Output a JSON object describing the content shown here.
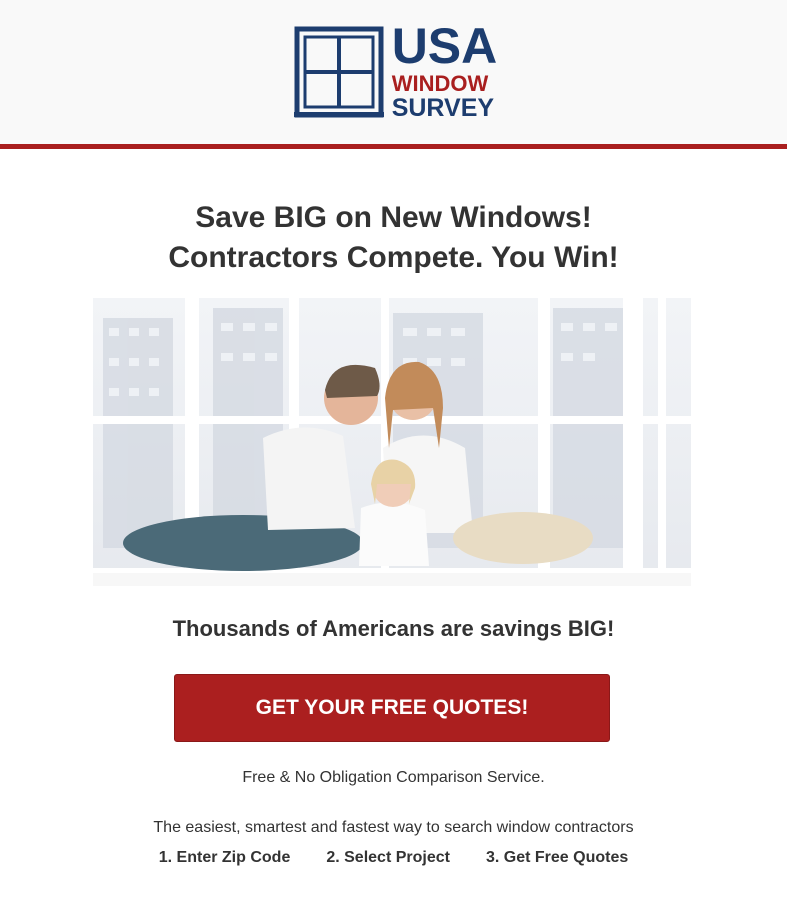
{
  "header": {
    "logo": {
      "line1": "USA",
      "line2": "WINDOW",
      "line3": "SURVEY",
      "icon": "window-icon",
      "colors": {
        "navy": "#1d3d6f",
        "red": "#a91f1f"
      }
    }
  },
  "main": {
    "headline_line1": "Save BIG on New Windows!",
    "headline_line2": "Contractors Compete. You Win!",
    "hero_image": "family-sitting-by-window-photo",
    "subheadline": "Thousands of Americans are savings BIG!",
    "cta_label": "GET YOUR FREE QUOTES!",
    "disclaimer": "Free & No Obligation Comparison Service.",
    "tagline": "The easiest, smartest and fastest way to search window contractors",
    "steps": [
      "1. Enter Zip Code",
      "2. Select Project",
      "3. Get Free Quotes"
    ]
  },
  "colors": {
    "accent": "#ab1f1f",
    "text": "#333333",
    "header_bg": "#f9f9f9"
  }
}
